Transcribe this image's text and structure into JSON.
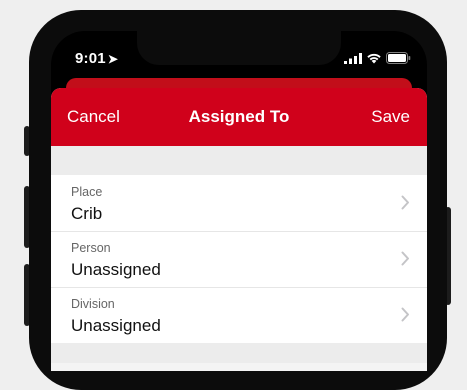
{
  "status_bar": {
    "time": "9:01",
    "location_icon": "location-arrow-icon",
    "signal_icon": "cellular-signal-icon",
    "wifi_icon": "wifi-icon",
    "battery_icon": "battery-icon"
  },
  "navbar": {
    "cancel_label": "Cancel",
    "title": "Assigned To",
    "save_label": "Save",
    "accent_color": "#d0011b"
  },
  "fields": [
    {
      "label": "Place",
      "value": "Crib"
    },
    {
      "label": "Person",
      "value": "Unassigned"
    },
    {
      "label": "Division",
      "value": "Unassigned"
    }
  ]
}
